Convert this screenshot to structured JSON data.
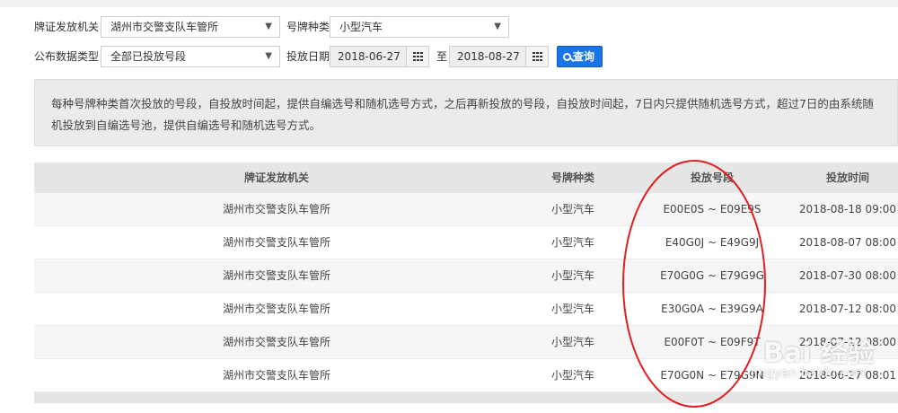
{
  "filters": {
    "issuer_label": "牌证发放机关",
    "issuer_value": "湖州市交警支队车管所",
    "plate_type_label": "号牌种类",
    "plate_type_value": "小型汽车",
    "data_type_label": "公布数据类型",
    "data_type_value": "全部已投放号段",
    "date_label": "投放日期",
    "date_from": "2018-06-27",
    "date_sep": "至",
    "date_to": "2018-08-27",
    "query_label": "查询"
  },
  "notice": "每种号牌种类首次投放的号段，自投放时间起，提供自编选号和随机选号方式，之后再新投放的号段，自投放时间起，7日内只提供随机选号方式，超过7日的由系统随机投放到自编选号池，提供自编选号和随机选号方式。",
  "table": {
    "headers": [
      "牌证发放机关",
      "号牌种类",
      "投放号段",
      "投放时间"
    ],
    "rows": [
      [
        "湖州市交警支队车管所",
        "小型汽车",
        "E00E0S ~ E09E9S",
        "2018-08-18 09:00"
      ],
      [
        "湖州市交警支队车管所",
        "小型汽车",
        "E40G0J ~ E49G9J",
        "2018-08-07 08:00"
      ],
      [
        "湖州市交警支队车管所",
        "小型汽车",
        "E70G0G ~ E79G9G",
        "2018-07-30 08:00"
      ],
      [
        "湖州市交警支队车管所",
        "小型汽车",
        "E30G0A ~ E39G9A",
        "2018-07-12 08:00"
      ],
      [
        "湖州市交警支队车管所",
        "小型汽车",
        "E00F0T ~ E09F9T",
        "2018-07-12 08:00"
      ],
      [
        "湖州市交警支队车管所",
        "小型汽车",
        "E70G0N ~ E79G9N",
        "2018-06-27 08:01"
      ]
    ]
  },
  "watermark": {
    "logo": "Bai 经验",
    "url": "jingyan.baidu.com"
  },
  "colors": {
    "accent": "#1a73e8",
    "annotation": "#e02020"
  }
}
